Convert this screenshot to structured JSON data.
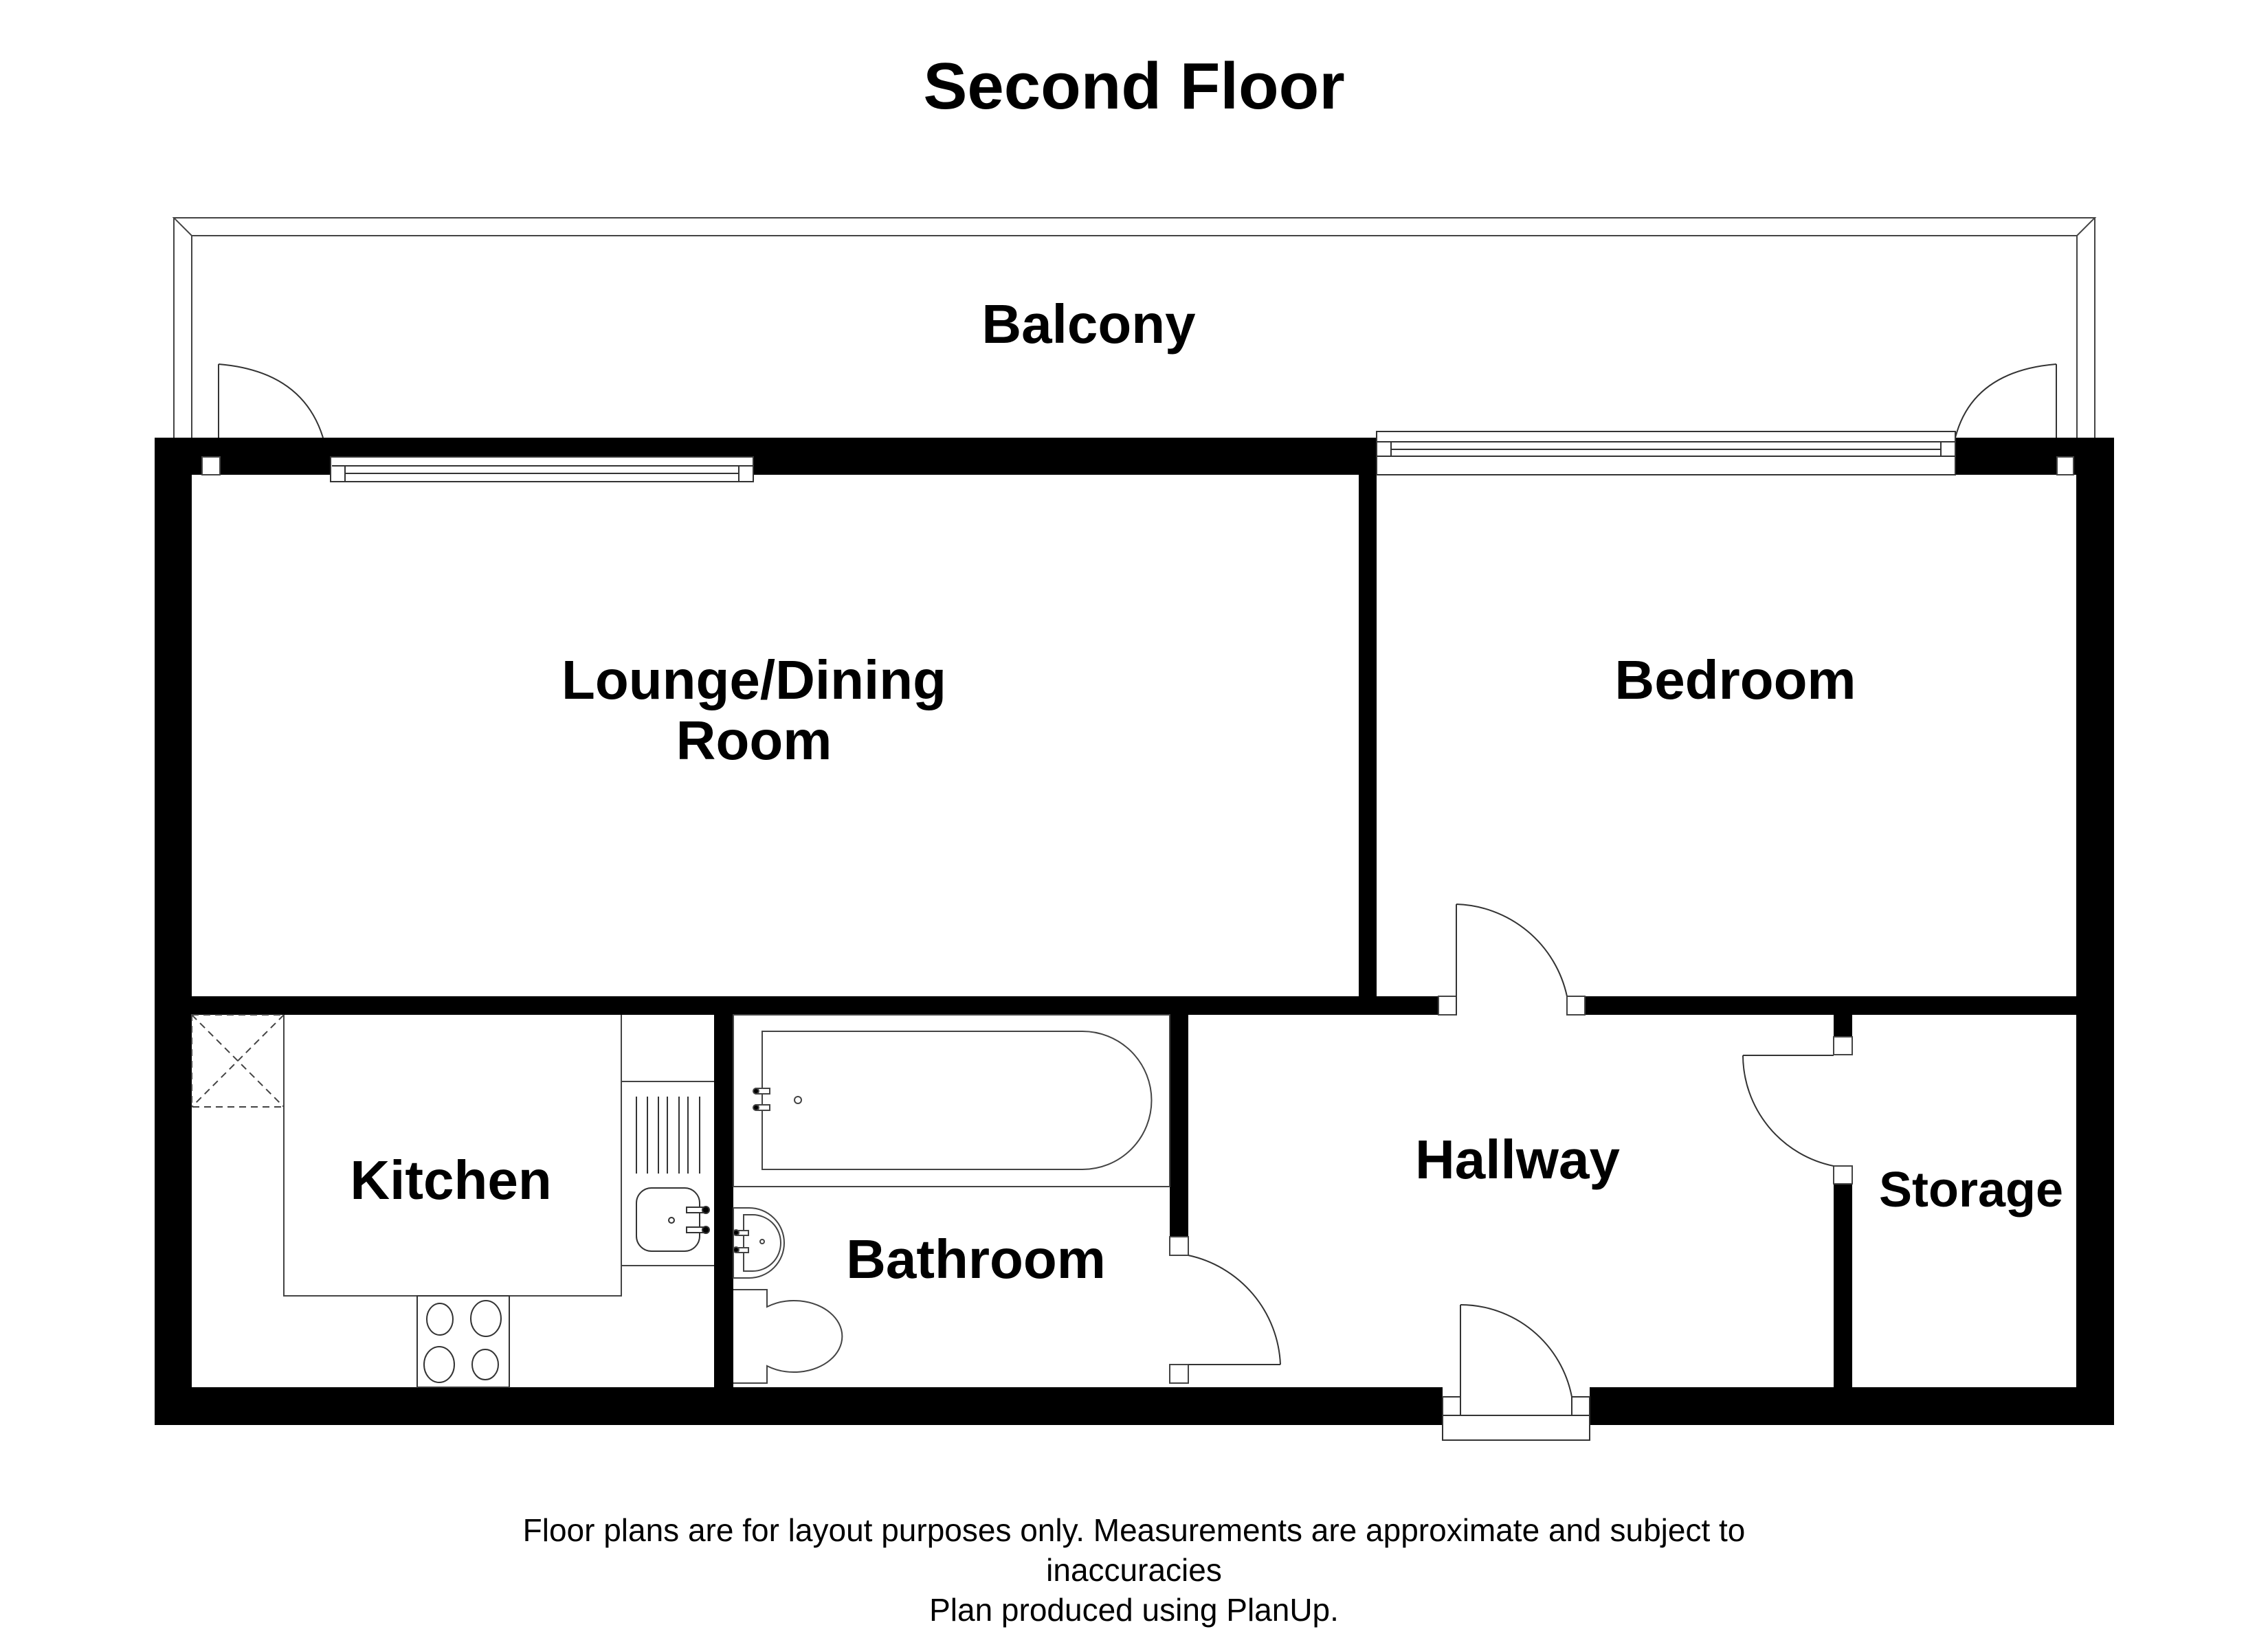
{
  "plan": {
    "title": "Second Floor",
    "rooms": [
      {
        "id": "balcony",
        "label": "Balcony"
      },
      {
        "id": "lounge",
        "label_lines": [
          "Lounge/Dining",
          "Room"
        ]
      },
      {
        "id": "bedroom",
        "label": "Bedroom"
      },
      {
        "id": "kitchen",
        "label": "Kitchen"
      },
      {
        "id": "bathroom",
        "label": "Bathroom"
      },
      {
        "id": "hallway",
        "label": "Hallway"
      },
      {
        "id": "storage",
        "label": "Storage"
      }
    ],
    "fixtures": [
      "bath",
      "wash-basin",
      "toilet",
      "kitchen-sink",
      "drainer",
      "hob",
      "boiler-cupboard",
      "sliding-window",
      "door"
    ]
  },
  "footer": {
    "line1": "Floor plans are for layout purposes only. Measurements are approximate and subject to",
    "line2": "inaccuracies",
    "line3": "Plan produced using PlanUp."
  },
  "colors": {
    "wall": "#000000",
    "line": "#333333",
    "background": "#ffffff"
  }
}
